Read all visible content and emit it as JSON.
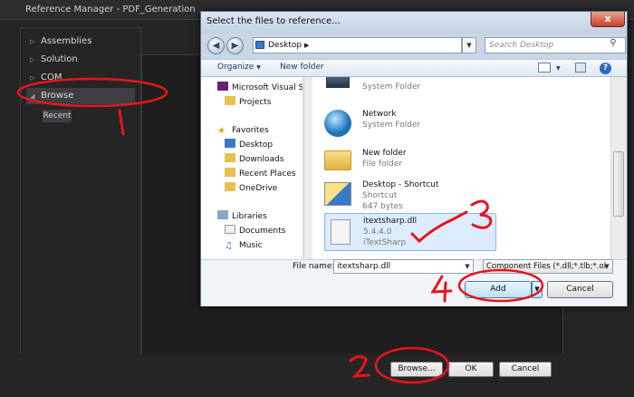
{
  "reference_manager": {
    "title": "Reference Manager - PDF_Generation",
    "tree": [
      "Assemblies",
      "Solution",
      "COM",
      "Browse"
    ],
    "recent": "Recent",
    "buttons": {
      "browse": "Browse...",
      "ok": "OK",
      "cancel": "Cancel"
    }
  },
  "dialog": {
    "title": "Select the files to reference...",
    "close": "x",
    "address": "Desktop",
    "search_placeholder": "Search Desktop",
    "toolbar": {
      "organize": "Organize",
      "new_folder": "New folder"
    },
    "nav_tree": [
      {
        "label": "Microsoft Visual St",
        "icon": "vs-icon"
      },
      {
        "label": "Projects",
        "icon": "folder-icon"
      },
      {
        "label": "Favorites",
        "icon": "star-icon"
      },
      {
        "label": "Desktop",
        "icon": "desktop-icon"
      },
      {
        "label": "Downloads",
        "icon": "folder-icon"
      },
      {
        "label": "Recent Places",
        "icon": "folder-icon"
      },
      {
        "label": "OneDrive",
        "icon": "folder-icon"
      },
      {
        "label": "Libraries",
        "icon": "library-icon"
      },
      {
        "label": "Documents",
        "icon": "document-icon"
      },
      {
        "label": "Music",
        "icon": "music-icon"
      }
    ],
    "files": [
      {
        "name": "",
        "sub1": "System Folder",
        "sub2": "",
        "icon": "computer-icon"
      },
      {
        "name": "Network",
        "sub1": "System Folder",
        "sub2": "",
        "icon": "network-icon"
      },
      {
        "name": "New folder",
        "sub1": "File folder",
        "sub2": "",
        "icon": "folder-icon"
      },
      {
        "name": "Desktop - Shortcut",
        "sub1": "Shortcut",
        "sub2": "647 bytes",
        "icon": "shortcut-icon"
      },
      {
        "name": "itextsharp.dll",
        "sub1": "5.4.4.0",
        "sub2": "iTextSharp",
        "icon": "dll-icon"
      }
    ],
    "file_name_label": "File name:",
    "file_name_value": "itextsharp.dll",
    "filter": "Component Files (*.dll;*.tlb;*.ol",
    "add": "Add",
    "cancel": "Cancel"
  },
  "annotations": [
    "1",
    "2",
    "3",
    "4"
  ],
  "colors": {
    "annotation": "#e8141b",
    "dark_bg": "#252526",
    "dialog_frame": "#c9d6e6"
  }
}
